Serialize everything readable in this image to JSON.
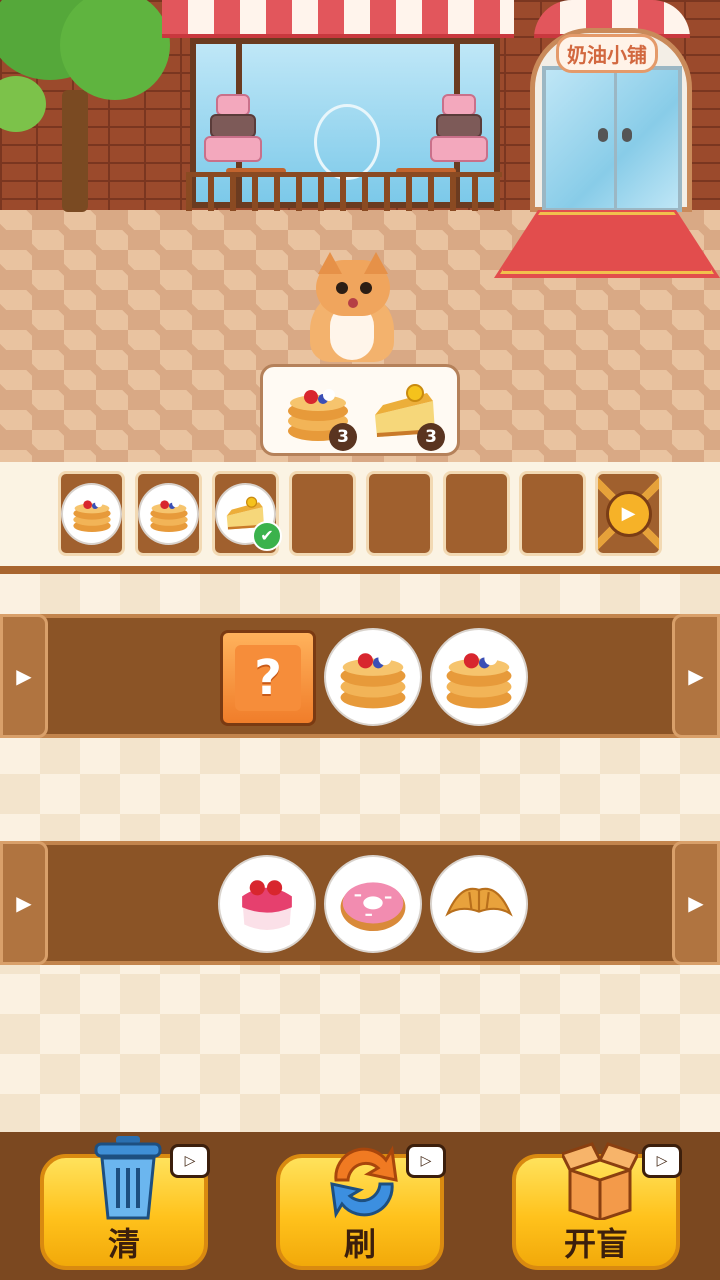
{
  "scene": {
    "shop_sign": "奶油小铺",
    "order": [
      {
        "item": "pancake-icon",
        "count": "3"
      },
      {
        "item": "cheesecake-icon",
        "count": "3"
      }
    ]
  },
  "collection_slots": [
    {
      "item": "pancake-icon",
      "matched": false
    },
    {
      "item": "pancake-icon",
      "matched": false
    },
    {
      "item": "cheesecake-icon",
      "matched": true
    },
    {
      "item": null
    },
    {
      "item": null
    },
    {
      "item": null
    },
    {
      "item": null
    },
    {
      "item": "locked-video-slot"
    }
  ],
  "shelves": [
    {
      "items": [
        "mystery-box",
        "pancake-icon",
        "pancake-icon"
      ]
    },
    {
      "items": [
        "pudding-icon",
        "donut-icon",
        "croissant-icon"
      ]
    }
  ],
  "mystery_mark": "?",
  "arrow_glyph": "▶",
  "toolbar": {
    "clear_label": "清",
    "refresh_label": "刷",
    "blindbox_label": "开盲"
  },
  "colors": {
    "shelf": "#8b5426",
    "button": "#ffc21c",
    "toolbar_bg": "#7b4820"
  }
}
